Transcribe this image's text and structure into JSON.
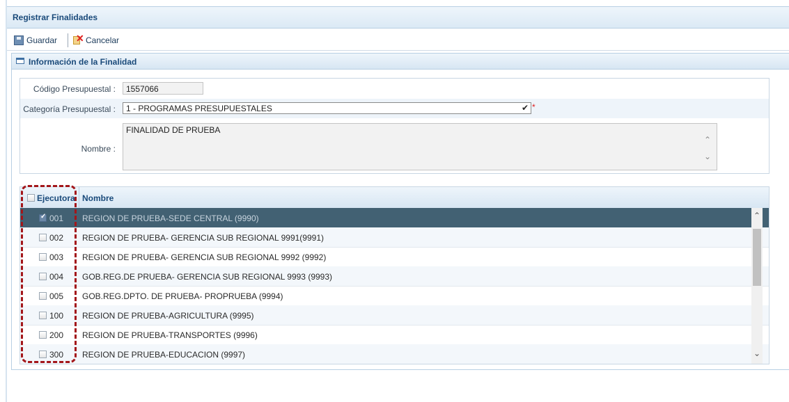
{
  "window": {
    "title": "Registrar Finalidades"
  },
  "toolbar": {
    "save_label": "Guardar",
    "cancel_label": "Cancelar"
  },
  "panel": {
    "title": "Información de la Finalidad"
  },
  "form": {
    "codigo_label": "Código Presupuestal :",
    "codigo_value": "1557066",
    "categoria_label": "Categoría Presupuestal :",
    "categoria_value": "1 - PROGRAMAS PRESUPUESTALES",
    "required_mark": "*",
    "nombre_label": "Nombre :",
    "nombre_value": "FINALIDAD DE PRUEBA"
  },
  "grid": {
    "columns": [
      "Ejecutora",
      "Nombre"
    ],
    "rows": [
      {
        "code": "001",
        "name": "REGION DE PRUEBA-SEDE CENTRAL (9990)",
        "checked": true,
        "selected": true
      },
      {
        "code": "002",
        "name": "REGION DE PRUEBA- GERENCIA SUB REGIONAL 9991(9991)",
        "checked": false
      },
      {
        "code": "003",
        "name": "REGION DE PRUEBA- GERENCIA SUB REGIONAL 9992 (9992)",
        "checked": false
      },
      {
        "code": "004",
        "name": "GOB.REG.DE PRUEBA- GERENCIA SUB REGIONAL 9993 (9993)",
        "checked": false
      },
      {
        "code": "005",
        "name": "GOB.REG.DPTO. DE PRUEBA- PROPRUEBA (9994)",
        "checked": false
      },
      {
        "code": "100",
        "name": "REGION DE PRUEBA-AGRICULTURA (9995)",
        "checked": false
      },
      {
        "code": "200",
        "name": "REGION DE PRUEBA-TRANSPORTES (9996)",
        "checked": false
      },
      {
        "code": "300",
        "name": "REGION DE PRUEBA-EDUCACION (9997)",
        "checked": false
      }
    ]
  },
  "colors": {
    "selected_row": "#426173",
    "highlight_box": "#a3161a",
    "header_text": "#1a4a7a"
  }
}
